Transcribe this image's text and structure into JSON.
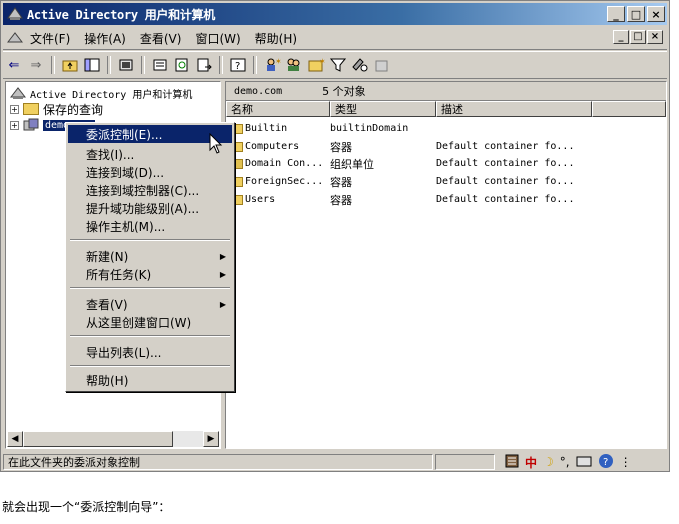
{
  "window": {
    "title": "Active Directory 用户和计算机",
    "controls": [
      "_",
      "□",
      "×"
    ],
    "mdi_controls": [
      "_",
      "□",
      "×"
    ]
  },
  "menubar": {
    "items": [
      "文件(F)",
      "操作(A)",
      "查看(V)",
      "窗口(W)",
      "帮助(H)"
    ]
  },
  "toolbar": {
    "icons": [
      "back-arrow-icon",
      "forward-arrow-icon",
      "up-folder-icon",
      "show-hide-tree-icon",
      "delete-icon",
      "properties-icon",
      "refresh-icon",
      "export-icon",
      "help-icon",
      "new-user-icon",
      "new-group-icon",
      "new-ou-icon",
      "filter-icon",
      "find-icon",
      "add-to-group-icon"
    ]
  },
  "tree": {
    "root_label": "Active Directory 用户和计算机",
    "saved_queries_label": "保存的查询",
    "domain_label": "demo.com"
  },
  "list": {
    "path": "demo.com",
    "count": "5 个对象",
    "columns": [
      "名称",
      "类型",
      "描述"
    ],
    "rows": [
      {
        "name": "Builtin",
        "type": "builtinDomain",
        "desc": ""
      },
      {
        "name": "Computers",
        "type": "容器",
        "desc": "Default container fo..."
      },
      {
        "name": "Domain Con...",
        "type": "组织单位",
        "desc": "Default container fo..."
      },
      {
        "name": "ForeignSec...",
        "type": "容器",
        "desc": "Default container fo..."
      },
      {
        "name": "Users",
        "type": "容器",
        "desc": "Default container fo..."
      }
    ]
  },
  "context_menu": {
    "items": [
      {
        "label": "委派控制(E)...",
        "highlighted": true
      },
      {
        "label": "查找(I)..."
      },
      {
        "label": "连接到域(D)..."
      },
      {
        "label": "连接到域控制器(C)..."
      },
      {
        "label": "提升域功能级别(A)..."
      },
      {
        "label": "操作主机(M)..."
      },
      {
        "label": "新建(N)",
        "submenu": true
      },
      {
        "label": "所有任务(K)",
        "submenu": true
      },
      {
        "label": "查看(V)",
        "submenu": true
      },
      {
        "label": "从这里创建窗口(W)"
      },
      {
        "label": "导出列表(L)..."
      },
      {
        "label": "帮助(H)"
      }
    ]
  },
  "statusbar": {
    "text": "在此文件夹的委派对象控制",
    "ime": "中"
  },
  "caption": "就会出现一个“委派控制向导”："
}
